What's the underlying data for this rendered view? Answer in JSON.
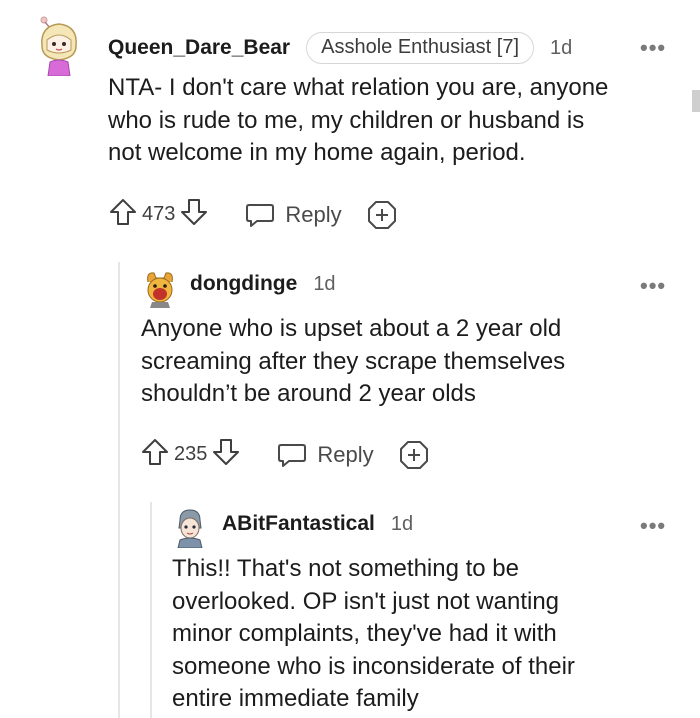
{
  "comments": [
    {
      "username": "Queen_Dare_Bear",
      "flair": "Asshole Enthusiast [7]",
      "time": "1d",
      "more": "•••",
      "lines": [
        "NTA- I don't care what relation you are, anyone",
        "who is rude to me, my children or husband is",
        "not welcome in my home again, period."
      ],
      "score": "473",
      "reply_label": "Reply"
    },
    {
      "username": "dongdinge",
      "time": "1d",
      "more": "•••",
      "lines": [
        "Anyone who is upset about a 2 year old",
        "screaming after they scrape themselves",
        "shouldn’t be around 2 year olds"
      ],
      "score": "235",
      "reply_label": "Reply"
    },
    {
      "username": "ABitFantastical",
      "time": "1d",
      "more": "•••",
      "lines": [
        "This!! That's not something to be",
        "overlooked. OP isn't just not wanting",
        "minor complaints, they've had it with",
        "someone who is inconsiderate of their",
        "entire immediate family"
      ]
    }
  ],
  "icons": {
    "upvote": "arrow-up-icon",
    "downvote": "arrow-down-icon",
    "reply": "speech-bubble-icon",
    "award": "award-plus-icon",
    "more": "more-dots-icon"
  },
  "colors": {
    "text": "#1c1c1c",
    "muted": "#5f5f5f",
    "flair_border": "#d6d6d6",
    "thread_line": "#e6e6e6"
  }
}
